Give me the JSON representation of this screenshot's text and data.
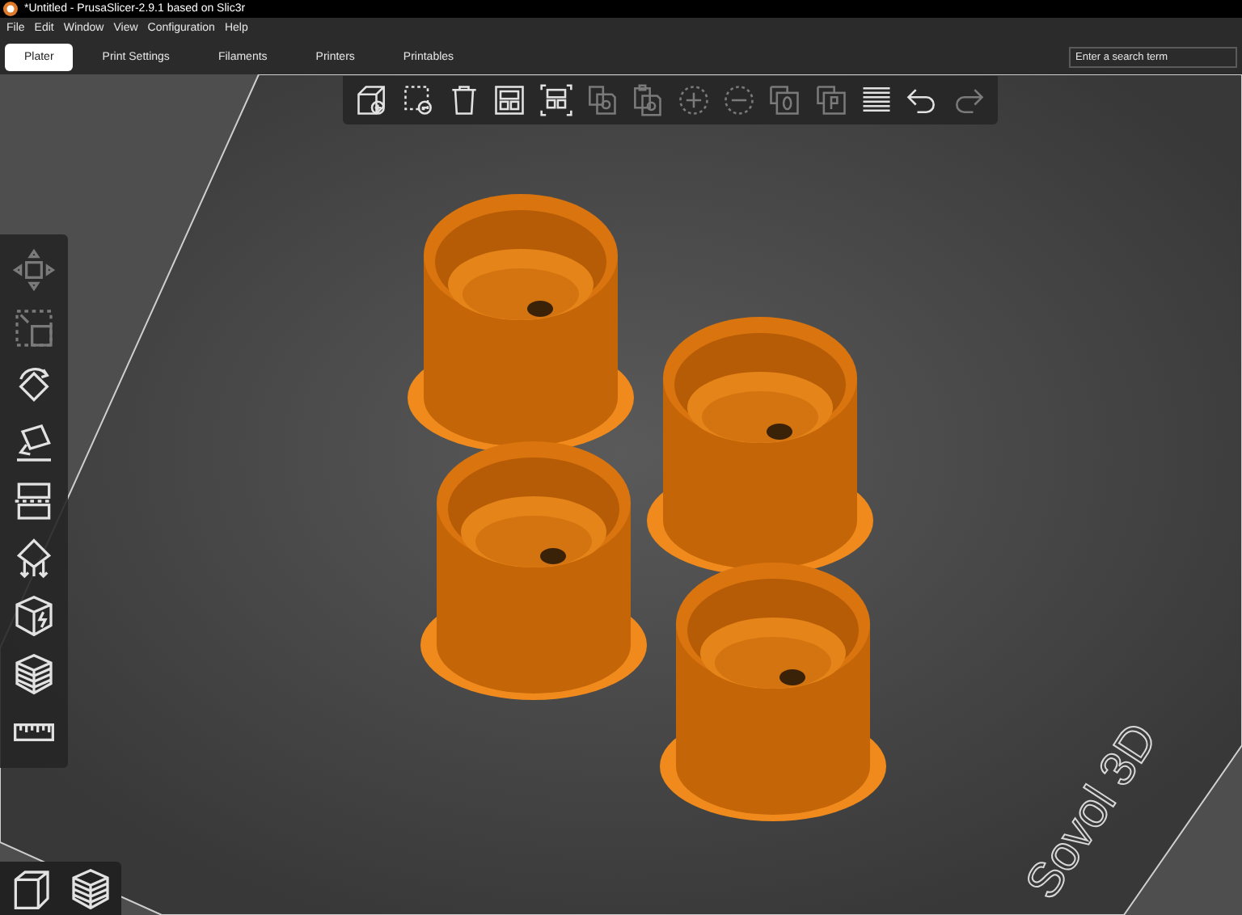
{
  "window": {
    "title": "*Untitled - PrusaSlicer-2.9.1 based on Slic3r"
  },
  "menu": [
    "File",
    "Edit",
    "Window",
    "View",
    "Configuration",
    "Help"
  ],
  "tabs": [
    {
      "label": "Plater",
      "selected": true
    },
    {
      "label": "Print Settings",
      "selected": false
    },
    {
      "label": "Filaments",
      "selected": false
    },
    {
      "label": "Printers",
      "selected": false
    },
    {
      "label": "Printables",
      "selected": false
    }
  ],
  "search": {
    "placeholder": "Enter a search term"
  },
  "top_toolbar": [
    {
      "kind": "add",
      "disabled": false
    },
    {
      "kind": "delete",
      "disabled": false
    },
    {
      "kind": "delete_all",
      "disabled": false
    },
    {
      "kind": "arrange",
      "disabled": false
    },
    {
      "kind": "arrange_selection",
      "disabled": false
    },
    {
      "kind": "copy",
      "disabled": true
    },
    {
      "kind": "paste",
      "disabled": true
    },
    {
      "kind": "instance_add",
      "disabled": true
    },
    {
      "kind": "instance_remove",
      "disabled": true
    },
    {
      "kind": "split_objects",
      "disabled": true
    },
    {
      "kind": "split_parts",
      "disabled": true
    },
    {
      "kind": "layers",
      "disabled": false
    },
    {
      "kind": "undo",
      "disabled": false
    },
    {
      "kind": "redo",
      "disabled": true
    }
  ],
  "left_toolbar": [
    {
      "kind": "move",
      "disabled": true
    },
    {
      "kind": "scale",
      "disabled": true
    },
    {
      "kind": "rotate",
      "disabled": false
    },
    {
      "kind": "place_on_face",
      "disabled": false
    },
    {
      "kind": "cut",
      "disabled": false
    },
    {
      "kind": "supports",
      "disabled": false
    },
    {
      "kind": "seam",
      "disabled": false
    },
    {
      "kind": "layer_range",
      "disabled": false
    },
    {
      "kind": "measure",
      "disabled": false
    }
  ],
  "view_toggle": [
    {
      "kind": "view3d"
    },
    {
      "kind": "preview"
    }
  ],
  "bed_label": "Sovol 3D"
}
